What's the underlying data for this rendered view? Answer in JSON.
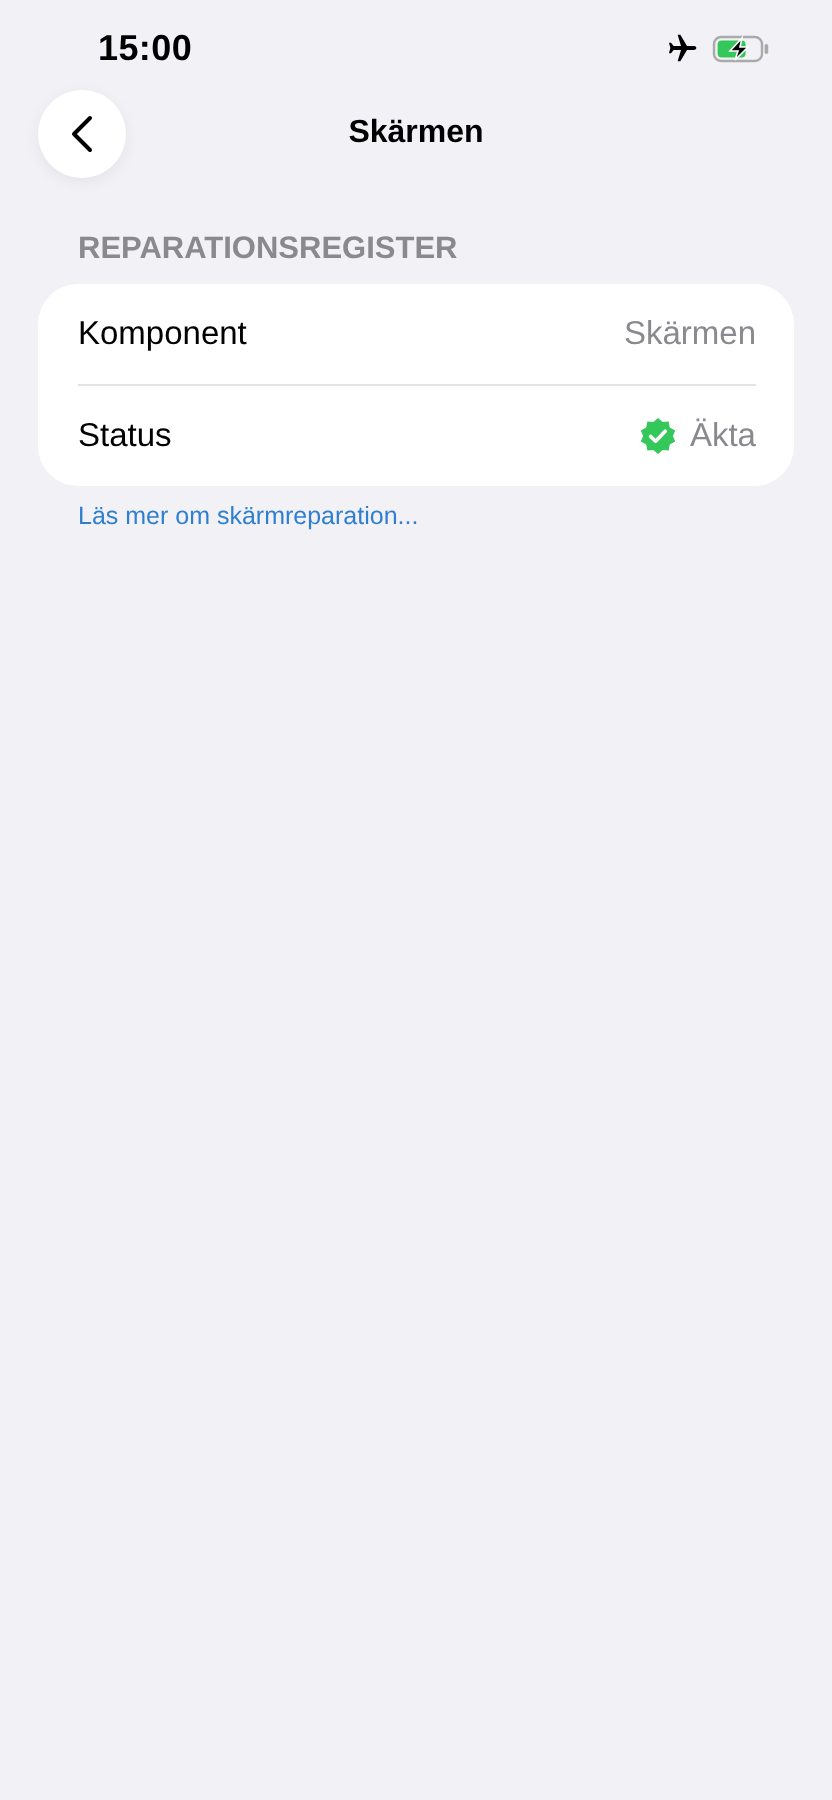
{
  "status_bar": {
    "time": "15:00",
    "airplane_mode": true,
    "charging": true
  },
  "nav": {
    "title": "Skärmen"
  },
  "section": {
    "header": "REPARATIONSREGISTER",
    "rows": [
      {
        "kind": "plain",
        "label": "Komponent",
        "value": "Skärmen"
      },
      {
        "kind": "verified",
        "label": "Status",
        "value": "Äkta"
      }
    ]
  },
  "link": "Läs mer om skärmreparation..."
}
